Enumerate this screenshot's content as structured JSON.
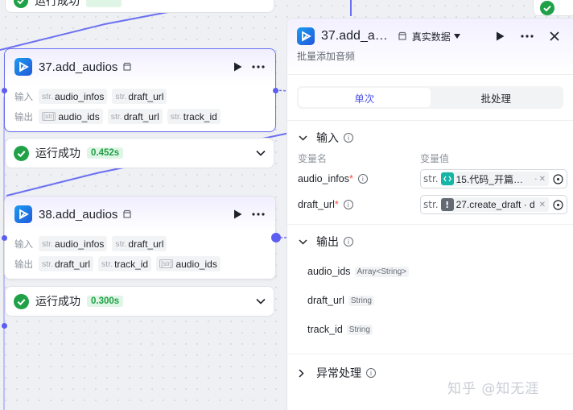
{
  "top_status": {
    "text": "运行成功"
  },
  "node37": {
    "title": "37.add_audios",
    "input_label": "输入",
    "output_label": "输出",
    "inputs": [
      {
        "prefix": "str.",
        "name": "audio_infos"
      },
      {
        "prefix": "str.",
        "name": "draft_url"
      }
    ],
    "outputs": [
      {
        "prefix": "[str]",
        "name": "audio_ids"
      },
      {
        "prefix": "str.",
        "name": "draft_url"
      },
      {
        "prefix": "str.",
        "name": "track_id"
      }
    ],
    "status": "运行成功",
    "time": "0.452s"
  },
  "node38": {
    "title": "38.add_audios",
    "input_label": "输入",
    "output_label": "输出",
    "inputs": [
      {
        "prefix": "str.",
        "name": "audio_infos"
      },
      {
        "prefix": "str.",
        "name": "draft_url"
      }
    ],
    "outputs": [
      {
        "prefix": "str.",
        "name": "draft_url"
      },
      {
        "prefix": "str.",
        "name": "track_id"
      },
      {
        "prefix": "[str]",
        "name": "audio_ids"
      }
    ],
    "status": "运行成功",
    "time": "0.300s"
  },
  "panel": {
    "title": "37.add_a…",
    "data_mode": "真实数据",
    "description": "批量添加音频",
    "tabs": [
      "单次",
      "批处理"
    ],
    "input_section": "输入",
    "col_name": "变量名",
    "col_value": "变量值",
    "vars": [
      {
        "name": "audio_infos",
        "prefix": "str.",
        "ref": "15.代码_开篇…",
        "ref_suffix": "·",
        "icon": "code-icon"
      },
      {
        "name": "draft_url",
        "prefix": "str.",
        "ref": "27.create_draft · d",
        "ref_suffix": "",
        "icon": "warning-icon"
      }
    ],
    "output_section": "输出",
    "outputs": [
      {
        "name": "audio_ids",
        "type": "Array<String>"
      },
      {
        "name": "draft_url",
        "type": "String"
      },
      {
        "name": "track_id",
        "type": "String"
      }
    ],
    "error_section": "异常处理"
  },
  "watermark": "知乎 @知无涯",
  "colors": {
    "accent": "#4d53e8",
    "edge": "#5b5ef0",
    "success": "#20a147"
  }
}
